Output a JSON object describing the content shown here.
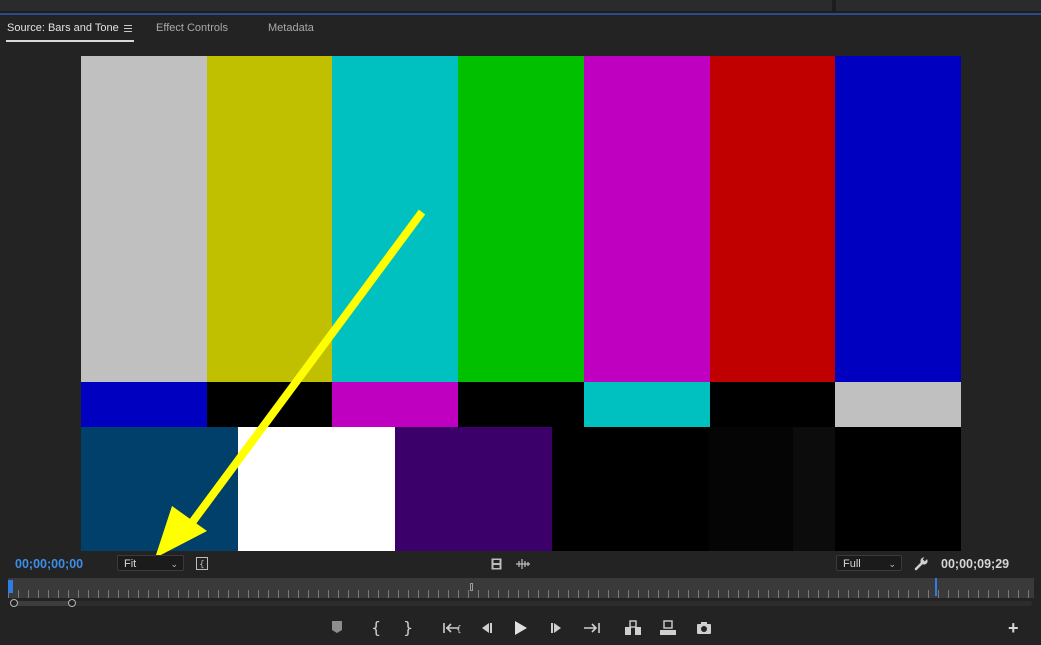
{
  "panel": {
    "tabs": [
      {
        "label": "Source: Bars and Tone",
        "active": true
      },
      {
        "label": "Effect Controls",
        "active": false
      },
      {
        "label": "Metadata",
        "active": false
      }
    ]
  },
  "viewer": {
    "top_bars": [
      "#c0c0c0",
      "#c0c000",
      "#00c0c0",
      "#00c000",
      "#c000c0",
      "#c00000",
      "#0000c0"
    ],
    "middle_bars": [
      "#0000c0",
      "#000000",
      "#c000c0",
      "#000000",
      "#00c0c0",
      "#000000",
      "#c0c0c0"
    ],
    "bottom_bars": [
      "#00406a",
      "#ffffff",
      "#3b006a",
      "#000000",
      "#050505",
      "#0c0c0c",
      "#000000"
    ]
  },
  "controls": {
    "current_timecode": "00;00;00;00",
    "duration_timecode": "00;00;09;29",
    "zoom_value": "Fit",
    "quality_value": "Full",
    "playhead_progress": 0,
    "in_handle_position": 0,
    "out_handle_position": 0.057
  },
  "annotation": {
    "arrow_color": "#ffff00"
  },
  "icons": {
    "panel_menu": "hamburger-icon",
    "zoom_chevron": "chevron-down-icon",
    "quality_chevron": "chevron-down-icon",
    "settings": "wrench-icon",
    "add": "plus-icon"
  }
}
